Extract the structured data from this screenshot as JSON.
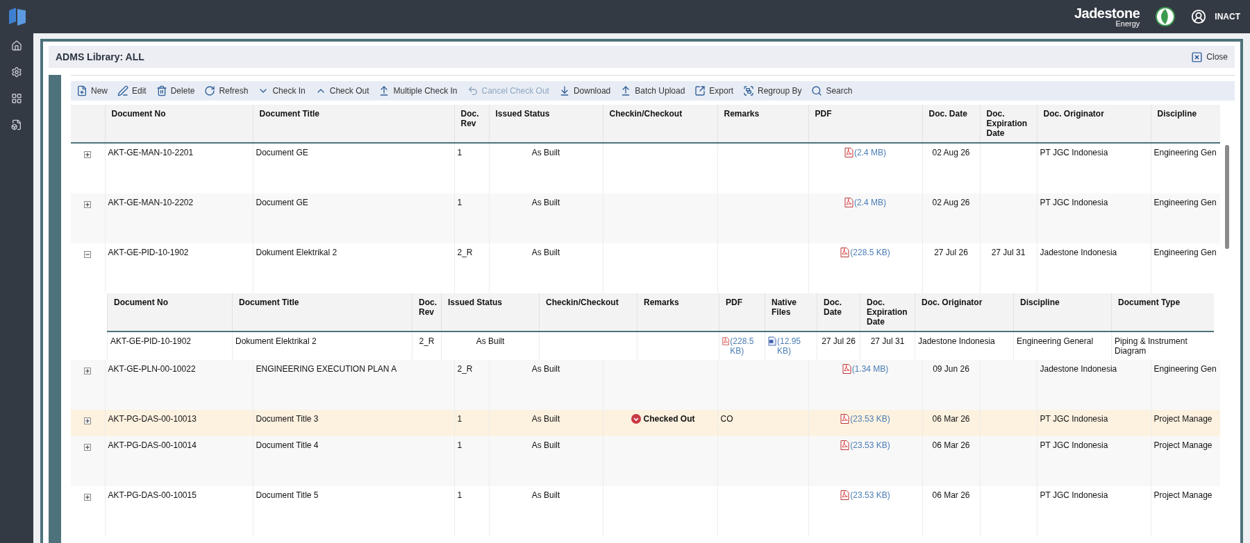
{
  "header": {
    "brand": "Jadestone",
    "brand_sub": "Energy",
    "user": "INACT"
  },
  "panel": {
    "title": "ADMS Library: ALL",
    "close": "Close"
  },
  "toolbar": [
    {
      "label": "New",
      "disabled": false
    },
    {
      "label": "Edit",
      "disabled": false
    },
    {
      "label": "Delete",
      "disabled": false
    },
    {
      "label": "Refresh",
      "disabled": false
    },
    {
      "label": "Check In",
      "disabled": false
    },
    {
      "label": "Check Out",
      "disabled": false
    },
    {
      "label": "Multiple Check In",
      "disabled": false
    },
    {
      "label": "Cancel Check Out",
      "disabled": true
    },
    {
      "label": "Download",
      "disabled": false
    },
    {
      "label": "Batch Upload",
      "disabled": false
    },
    {
      "label": "Export",
      "disabled": false
    },
    {
      "label": "Regroup By",
      "disabled": false
    },
    {
      "label": "Search",
      "disabled": false
    }
  ],
  "table": {
    "columns": [
      "Document No",
      "Document Title",
      "Doc. Rev",
      "Issued Status",
      "Checkin/Checkout",
      "Remarks",
      "PDF",
      "Doc. Date",
      "Doc. Expiration Date",
      "Doc. Originator",
      "Discipline"
    ],
    "rows": [
      {
        "expanded": false,
        "checked_out": false,
        "doc_no": "AKT-GE-MAN-10-2201",
        "title": "Document GE",
        "rev": "1",
        "status": "As Built",
        "pdf": "(2.4 MB)",
        "date": "02 Aug 26",
        "originator": "PT JGC Indonesia",
        "discipline": "Engineering Gen"
      },
      {
        "expanded": false,
        "checked_out": false,
        "doc_no": "AKT-GE-MAN-10-2202",
        "title": "Document GE",
        "rev": "1",
        "status": "As Built",
        "pdf": "(2.4 MB)",
        "date": "02 Aug 26",
        "originator": "PT JGC Indonesia",
        "discipline": "Engineering Gen"
      },
      {
        "expanded": true,
        "checked_out": false,
        "doc_no": "AKT-GE-PID-10-1902",
        "title": "Dokument Elektrikal 2",
        "rev": "2_R",
        "status": "As Built",
        "pdf": "(228.5 KB)",
        "date": "27 Jul 26",
        "expiration": "27 Jul 31",
        "originator": "Jadestone Indonesia",
        "discipline": "Engineering Gen",
        "detail": {
          "columns": [
            "Document No",
            "Document Title",
            "Doc. Rev",
            "Issued Status",
            "Checkin/Checkout",
            "Remarks",
            "PDF",
            "Native Files",
            "Doc. Date",
            "Doc. Expiration Date",
            "Doc. Originator",
            "Discipline",
            "Document Type"
          ],
          "rows": [
            {
              "doc_no": "AKT-GE-PID-10-1902",
              "title": "Dokument Elektrikal 2",
              "rev": "2_R",
              "status": "As Built",
              "pdf": "(228.5 KB)",
              "native": "(12.95 KB)",
              "date": "27 Jul 26",
              "expiration": "27 Jul 31",
              "originator": "Jadestone Indonesia",
              "discipline": "Engineering General",
              "doc_type": "Piping & Instrument Diagram"
            }
          ]
        }
      },
      {
        "expanded": false,
        "checked_out": false,
        "doc_no": "AKT-GE-PLN-00-10022",
        "title": "ENGINEERING EXECUTION PLAN A",
        "rev": "2_R",
        "status": "As Built",
        "pdf": "(1.34 MB)",
        "date": "09 Jun 26",
        "originator": "Jadestone Indonesia",
        "discipline": "Engineering Gen"
      },
      {
        "expanded": false,
        "checked_out": true,
        "doc_no": "AKT-PG-DAS-00-10013",
        "title": "Document Title 3",
        "rev": "1",
        "status": "As Built",
        "checkin": "Checked Out",
        "remarks": "CO",
        "pdf": "(23.53 KB)",
        "date": "06 Mar 26",
        "originator": "PT JGC Indonesia",
        "discipline": "Project Manage"
      },
      {
        "expanded": false,
        "checked_out": false,
        "doc_no": "AKT-PG-DAS-00-10014",
        "title": "Document Title 4",
        "rev": "1",
        "status": "As Built",
        "pdf": "(23.53 KB)",
        "date": "06 Mar 26",
        "originator": "PT JGC Indonesia",
        "discipline": "Project Manage"
      },
      {
        "expanded": false,
        "checked_out": false,
        "doc_no": "AKT-PG-DAS-00-10015",
        "title": "Document Title 5",
        "rev": "1",
        "status": "As Built",
        "pdf": "(23.53 KB)",
        "date": "06 Mar 26",
        "originator": "PT JGC Indonesia",
        "discipline": "Project Manage"
      }
    ]
  }
}
